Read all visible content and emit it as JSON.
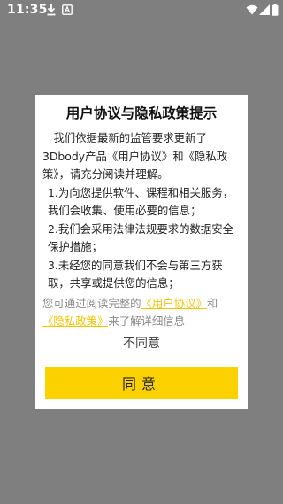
{
  "status_bar": {
    "time": "11:35"
  },
  "dialog": {
    "title": "用户协议与隐私政策提示",
    "paragraph_intro": "我们依据最新的监管要求更新了3Dbody产品《用户协议》和《隐私政策》，请充分阅读并理解。",
    "item_1": "1.为向您提供软件、课程和相关服务，我们会收集、使用必要的信息；",
    "item_2": "2.我们会采用法律法规要求的数据安全保护措施；",
    "item_3": "3.未经您的同意我们不会与第三方获取，共享或提供您的信息；",
    "info_prefix": "您可通过阅读完整的",
    "user_agreement_link": "《用户协议》",
    "info_and": "和",
    "privacy_policy_link": "《隐私政策》",
    "info_suffix": "来了解详细信息",
    "disagree_label": "不同意",
    "agree_label": "同意"
  },
  "colors": {
    "accent": "#fbd200",
    "link": "#f5c400",
    "overlay": "#7f7f7f"
  }
}
